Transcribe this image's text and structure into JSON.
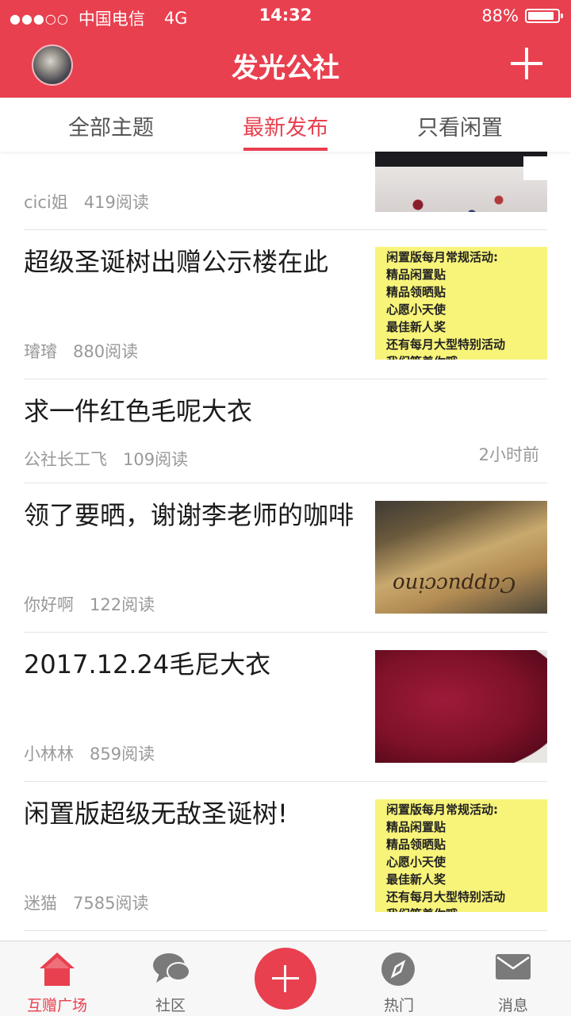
{
  "status_bar": {
    "signal": "●●●○○",
    "carrier": "中国电信",
    "network": "4G",
    "time": "14:32",
    "battery": "88%",
    "battery_level": 0.88
  },
  "header": {
    "title": "发光公社"
  },
  "tabs": [
    {
      "label": "全部主题"
    },
    {
      "label": "最新发布"
    },
    {
      "label": "只看闲置"
    }
  ],
  "posts": [
    {
      "title": "",
      "author": "cici姐",
      "reads": "419阅读"
    },
    {
      "title": "超级圣诞树出赠公示楼在此",
      "author": "璿璿",
      "reads": "880阅读"
    },
    {
      "title": "求一件红色毛呢大衣",
      "author": "公社长工飞",
      "reads": "109阅读",
      "time_ago": "2小时前"
    },
    {
      "title": "领了要晒，谢谢李老师的咖啡",
      "author": "你好啊",
      "reads": "122阅读"
    },
    {
      "title": "2017.12.24毛尼大衣",
      "author": "小林林",
      "reads": "859阅读"
    },
    {
      "title": "闲置版超级无敌圣诞树!",
      "author": "迷猫",
      "reads": "7585阅读"
    }
  ],
  "notice_image_text": "闲置版每月常规活动:\n精品闲置贴\n精品领晒贴\n心愿小天使\n最佳新人奖\n还有每月大型特别活动\n我们等着你哦",
  "coffee_image_text": "Cappuccino",
  "bottom_nav": [
    {
      "label": "互赠广场",
      "icon": "home-icon"
    },
    {
      "label": "社区",
      "icon": "chat-bubble-icon"
    },
    {
      "label": "",
      "icon": "plus-icon"
    },
    {
      "label": "热门",
      "icon": "compass-icon"
    },
    {
      "label": "消息",
      "icon": "mail-icon"
    }
  ],
  "colors": {
    "brand": "#e8404f",
    "text_secondary": "#999999"
  }
}
